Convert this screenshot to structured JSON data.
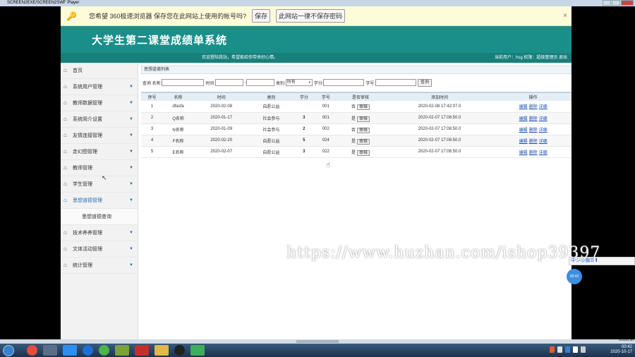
{
  "player": {
    "title": "SCREEN2EXE/SCREEN2SWF Player"
  },
  "password_bar": {
    "message": "您希望 360极速浏览器 保存您在此网站上使用的帐号吗?",
    "save_label": "保存",
    "never_label": "此网站一律不保存密码",
    "close": "×"
  },
  "header": {
    "title": "大学生第二课堂成绩单系统",
    "welcome": "欢迎登陆我站，希望能给你带来好心情。",
    "user_info": "当前用户：hsg  权限：超级管理员  退出"
  },
  "sidebar": {
    "items": [
      {
        "label": "首页",
        "arrow": ""
      },
      {
        "label": "系统用户管理",
        "arrow": "▼"
      },
      {
        "label": "教师数据管理",
        "arrow": "▼"
      },
      {
        "label": "系统简介设置",
        "arrow": "▼"
      },
      {
        "label": "友情连接管理",
        "arrow": "▼"
      },
      {
        "label": "走幻图管理",
        "arrow": "▼"
      },
      {
        "label": "教师管理",
        "arrow": "▼"
      },
      {
        "label": "学生管理",
        "arrow": "▼"
      },
      {
        "label": "思想道德管理",
        "arrow": "▼"
      }
    ],
    "submenu": "思想道德查询",
    "items2": [
      {
        "label": "技术养养管理",
        "arrow": "▼"
      },
      {
        "label": "文体活动管理",
        "arrow": "▼"
      },
      {
        "label": "统计管理",
        "arrow": "▼"
      }
    ]
  },
  "content": {
    "crumb": "思想道德列表",
    "search": {
      "query_label": "查询 名称:",
      "time_label": "时间:",
      "dash": "-",
      "category_label": "类别:",
      "category_value": "所有",
      "credit_label": "学分:",
      "student_label": "学号:",
      "button": "查询"
    },
    "table": {
      "headers": [
        "序号",
        "名称",
        "时间",
        "类别",
        "学分",
        "学号",
        "是否审核",
        "添加时间",
        "操作"
      ],
      "rows": [
        {
          "idx": "1",
          "name": "dfasfa",
          "date": "2020-02-08",
          "cat": "自愿公益",
          "credit": "",
          "sid": "001",
          "audit": "否",
          "added": "2020-02-08 17:42:07.0"
        },
        {
          "idx": "2",
          "name": "Q名称",
          "date": "2020-01-17",
          "cat": "社会参与",
          "credit": "3",
          "sid": "001",
          "audit": "是",
          "added": "2020-02-07 17:06:50.0"
        },
        {
          "idx": "3",
          "name": "N名称",
          "date": "2020-01-09",
          "cat": "社会参与",
          "credit": "2",
          "sid": "002",
          "audit": "否",
          "added": "2020-02-07 17:06:50.0"
        },
        {
          "idx": "4",
          "name": "F名称",
          "date": "2020-02-20",
          "cat": "自愿公益",
          "credit": "5",
          "sid": "024",
          "audit": "是",
          "added": "2020-02-07 17:06:50.0"
        },
        {
          "idx": "5",
          "name": "E名称",
          "date": "2020-02-07",
          "cat": "自愿公益",
          "credit": "3",
          "sid": "022",
          "audit": "是",
          "added": "2020-02-07 17:06:50.0"
        }
      ],
      "audit_btn": "审核",
      "ops": [
        "编辑",
        "删除",
        "详细"
      ]
    }
  },
  "watermark": "https://www.huzhan.com/ishop39397",
  "floatbar": "中ジ◎偏☰⬆",
  "floatball": "00:42",
  "scroll_time": "0:01/0:50",
  "tray": {
    "time": "00:42",
    "date": "2020-10-17"
  },
  "colors": {
    "banner": "#1a8f89",
    "subbar": "#187f7b",
    "link": "#1a4fb0",
    "accent": "#2a6db5"
  }
}
